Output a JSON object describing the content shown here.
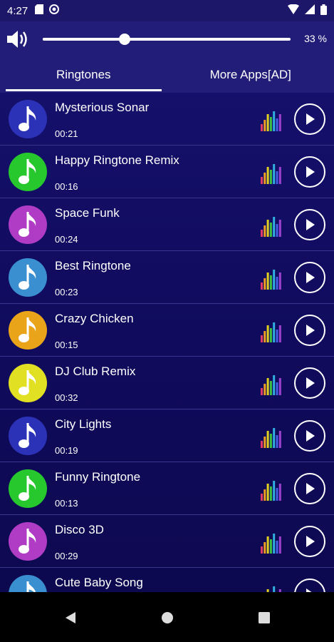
{
  "status_bar": {
    "time": "4:27"
  },
  "volume": {
    "percent_label": "33 %",
    "level": 0.33
  },
  "tabs": [
    {
      "label": "Ringtones",
      "active": true
    },
    {
      "label": "More Apps[AD]",
      "active": false
    }
  ],
  "ringtones": [
    {
      "title": "Mysterious Sonar",
      "duration": "00:21",
      "color": "#2c32b8"
    },
    {
      "title": "Happy Ringtone Remix",
      "duration": "00:16",
      "color": "#26c82e"
    },
    {
      "title": "Space Funk",
      "duration": "00:24",
      "color": "#b03cc6"
    },
    {
      "title": "Best Ringtone",
      "duration": "00:23",
      "color": "#3a8fd0"
    },
    {
      "title": "Crazy Chicken",
      "duration": "00:15",
      "color": "#eaa41a"
    },
    {
      "title": "DJ Club Remix",
      "duration": "00:32",
      "color": "#e2e022"
    },
    {
      "title": "City Lights",
      "duration": "00:19",
      "color": "#2c32b8"
    },
    {
      "title": "Funny Ringtone",
      "duration": "00:13",
      "color": "#26c82e"
    },
    {
      "title": "Disco 3D",
      "duration": "00:29",
      "color": "#b03cc6"
    },
    {
      "title": "Cute Baby Song",
      "duration": "",
      "color": "#3a8fd0"
    }
  ],
  "icons": {
    "volume": "speaker-icon",
    "play": "play-icon",
    "equalizer": "equalizer-icon",
    "note": "music-note-icon",
    "nav_back": "back-triangle-icon",
    "nav_home": "home-circle-icon",
    "nav_recents": "recents-square-icon"
  }
}
